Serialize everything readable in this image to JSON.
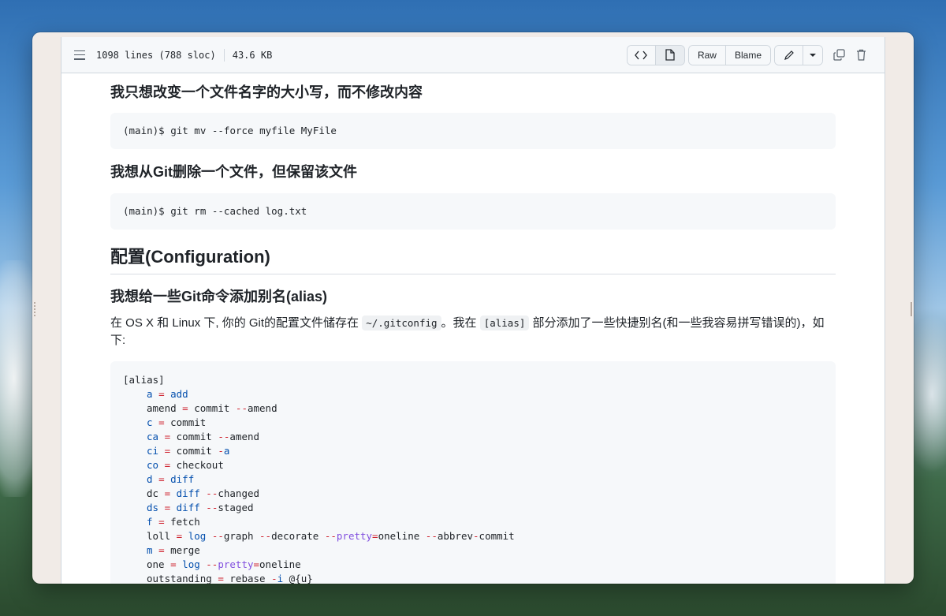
{
  "file_header": {
    "lines_info": "1098 lines (788 sloc)",
    "size": "43.6 KB",
    "raw_label": "Raw",
    "blame_label": "Blame",
    "icons": [
      "list-icon",
      "code-icon",
      "file-icon",
      "pencil-icon",
      "caret-down-icon",
      "copy-icon",
      "trash-icon"
    ]
  },
  "content": {
    "heading1": "我只想改变一个文件名字的大小写，而不修改内容",
    "code1": "(main)$ git mv --force myfile MyFile",
    "heading2": "我想从Git删除一个文件，但保留该文件",
    "code2": "(main)$ git rm --cached log.txt",
    "section_title": "配置(Configuration)",
    "heading3": "我想给一些Git命令添加别名(alias)",
    "para": {
      "t1": "在 OS X 和 Linux 下, 你的 Git的配置文件储存在 ",
      "c1": "~/.gitconfig",
      "t2": "。我在 ",
      "c2": "[alias]",
      "t3": " 部分添加了一些快捷别名(和一些我容易拼写错误的)，如下:"
    },
    "alias_block": {
      "header": "[alias]",
      "lines": [
        {
          "name": "a",
          "eq": "=",
          "parts": [
            {
              "t": "add",
              "c": "k"
            }
          ]
        },
        {
          "name": "amend",
          "eq": "=",
          "parts": [
            {
              "t": "commit ",
              "c": ""
            },
            {
              "t": "--",
              "c": "o"
            },
            {
              "t": "amend",
              "c": ""
            }
          ]
        },
        {
          "name": "c",
          "eq": "=",
          "parts": [
            {
              "t": "commit",
              "c": ""
            }
          ]
        },
        {
          "name": "ca",
          "eq": "=",
          "parts": [
            {
              "t": "commit ",
              "c": ""
            },
            {
              "t": "--",
              "c": "o"
            },
            {
              "t": "amend",
              "c": ""
            }
          ]
        },
        {
          "name": "ci",
          "eq": "=",
          "parts": [
            {
              "t": "commit ",
              "c": ""
            },
            {
              "t": "-",
              "c": "o"
            },
            {
              "t": "a",
              "c": "k"
            }
          ]
        },
        {
          "name": "co",
          "eq": "=",
          "parts": [
            {
              "t": "checkout",
              "c": ""
            }
          ]
        },
        {
          "name": "d",
          "eq": "=",
          "parts": [
            {
              "t": "diff",
              "c": "k"
            }
          ]
        },
        {
          "name": "dc",
          "eq": "=",
          "parts": [
            {
              "t": "diff",
              "c": "k"
            },
            {
              "t": " ",
              "c": ""
            },
            {
              "t": "--",
              "c": "o"
            },
            {
              "t": "changed",
              "c": ""
            }
          ]
        },
        {
          "name": "ds",
          "eq": "=",
          "parts": [
            {
              "t": "diff",
              "c": "k"
            },
            {
              "t": " ",
              "c": ""
            },
            {
              "t": "--",
              "c": "o"
            },
            {
              "t": "staged",
              "c": ""
            }
          ]
        },
        {
          "name": "f",
          "eq": "=",
          "parts": [
            {
              "t": "fetch",
              "c": ""
            }
          ]
        },
        {
          "name": "loll",
          "eq": "=",
          "parts": [
            {
              "t": "log",
              "c": "k"
            },
            {
              "t": " ",
              "c": ""
            },
            {
              "t": "--",
              "c": "o"
            },
            {
              "t": "graph ",
              "c": ""
            },
            {
              "t": "--",
              "c": "o"
            },
            {
              "t": "decorate ",
              "c": ""
            },
            {
              "t": "--",
              "c": "o"
            },
            {
              "t": "pretty",
              "c": "p"
            },
            {
              "t": "=",
              "c": "o"
            },
            {
              "t": "oneline ",
              "c": ""
            },
            {
              "t": "--",
              "c": "o"
            },
            {
              "t": "abbrev",
              "c": ""
            },
            {
              "t": "-",
              "c": "o"
            },
            {
              "t": "commit",
              "c": ""
            }
          ]
        },
        {
          "name": "m",
          "eq": "=",
          "parts": [
            {
              "t": "merge",
              "c": ""
            }
          ]
        },
        {
          "name": "one",
          "eq": "=",
          "parts": [
            {
              "t": "log",
              "c": "k"
            },
            {
              "t": " ",
              "c": ""
            },
            {
              "t": "--",
              "c": "o"
            },
            {
              "t": "pretty",
              "c": "p"
            },
            {
              "t": "=",
              "c": "o"
            },
            {
              "t": "oneline",
              "c": ""
            }
          ]
        },
        {
          "name": "outstanding",
          "eq": "=",
          "parts": [
            {
              "t": "rebase ",
              "c": ""
            },
            {
              "t": "-",
              "c": "o"
            },
            {
              "t": "i",
              "c": "k"
            },
            {
              "t": " @{u}",
              "c": ""
            }
          ]
        }
      ],
      "blue_names": [
        "a",
        "c",
        "ca",
        "ci",
        "co",
        "d",
        "ds",
        "f",
        "m"
      ]
    }
  }
}
